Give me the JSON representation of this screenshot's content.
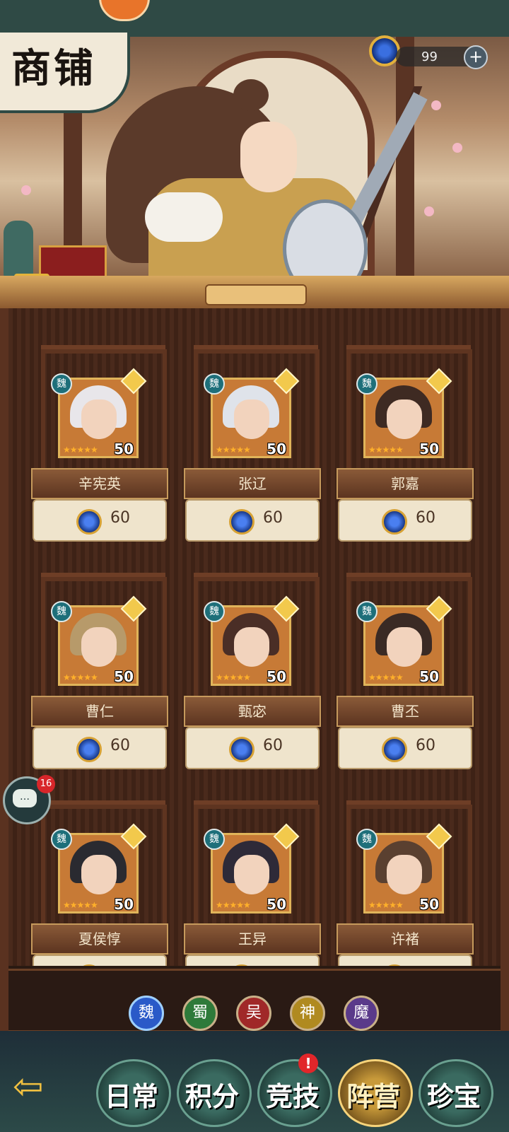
{
  "header": {
    "title": "商铺",
    "currency_amount": "99",
    "plus_symbol": "+"
  },
  "colors": {
    "accent_gold": "#e0b45a",
    "wei_badge": "#1e6f7a",
    "wood_dark": "#4a2a1c"
  },
  "heroes": [
    {
      "name": "辛宪英",
      "faction": "魏",
      "level": "50",
      "stars": "★★★★★",
      "price": "60",
      "hair": "#e8e6ea"
    },
    {
      "name": "张辽",
      "faction": "魏",
      "level": "50",
      "stars": "★★★★★",
      "price": "60",
      "hair": "#dfe3ea"
    },
    {
      "name": "郭嘉",
      "faction": "魏",
      "level": "50",
      "stars": "★★★★★",
      "price": "60",
      "hair": "#3e2a22"
    },
    {
      "name": "曹仁",
      "faction": "魏",
      "level": "50",
      "stars": "★★★★★",
      "price": "60",
      "hair": "#b79a6a"
    },
    {
      "name": "甄宓",
      "faction": "魏",
      "level": "50",
      "stars": "★★★★★",
      "price": "60",
      "hair": "#4a2e26"
    },
    {
      "name": "曹丕",
      "faction": "魏",
      "level": "50",
      "stars": "★★★★★",
      "price": "60",
      "hair": "#3a2a24"
    },
    {
      "name": "夏侯惇",
      "faction": "魏",
      "level": "50",
      "stars": "★★★★★",
      "price": "",
      "hair": "#2a2a30"
    },
    {
      "name": "王异",
      "faction": "魏",
      "level": "50",
      "stars": "★★★★★",
      "price": "",
      "hair": "#2e2a38"
    },
    {
      "name": "许褚",
      "faction": "魏",
      "level": "50",
      "stars": "★★★★★",
      "price": "",
      "hair": "#5a4030"
    }
  ],
  "chat": {
    "badge_count": "16",
    "icon": "…"
  },
  "factions": [
    {
      "label": "魏",
      "color": "#2a5ac8"
    },
    {
      "label": "蜀",
      "color": "#2e7a3a"
    },
    {
      "label": "吴",
      "color": "#a02828"
    },
    {
      "label": "神",
      "color": "#b08a20"
    },
    {
      "label": "魔",
      "color": "#5a3a8a"
    }
  ],
  "bottom_nav": {
    "back_symbol": "⇦",
    "tabs": [
      {
        "label": "日常"
      },
      {
        "label": "积分"
      },
      {
        "label": "竞技",
        "alert": "!"
      },
      {
        "label": "阵营"
      },
      {
        "label": "珍宝"
      }
    ]
  }
}
